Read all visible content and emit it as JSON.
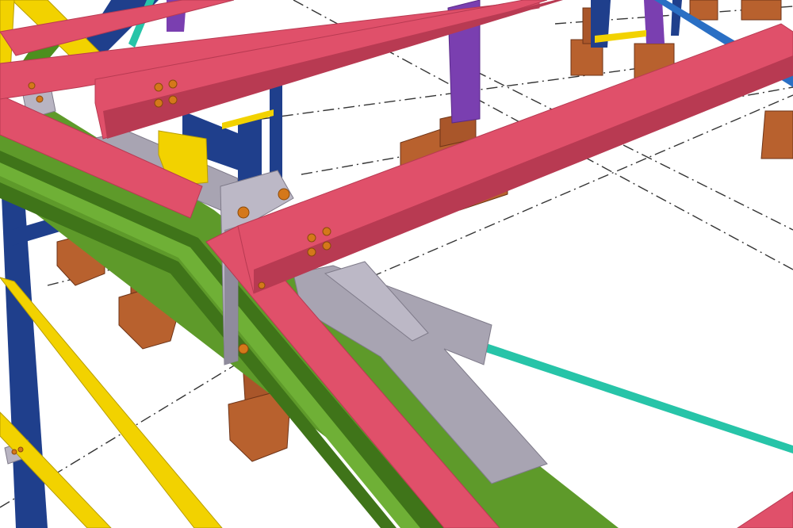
{
  "scene": {
    "kind": "3D structural steel model view",
    "colors": {
      "background": "#ffffff",
      "rafter_red": "#e0506a",
      "rafter_red_dark": "#b83a52",
      "beam_green": "#5e9a2a",
      "beam_green_dark": "#3f7419",
      "girt_yellow": "#f2d200",
      "column_blue": "#1f3f8c",
      "column_purple": "#7a3fb0",
      "footing_brown": "#b8612e",
      "footing_brown_dark": "#8c4420",
      "plate_grey": "#a8a4b2",
      "plate_grey_dark": "#7f7b8a",
      "bracing_cyan": "#27c4a8",
      "bolt_orange": "#d4781a",
      "gridline": "#333333"
    },
    "members": [
      {
        "name": "rafter",
        "color_key": "rafter_red"
      },
      {
        "name": "main-beam",
        "color_key": "beam_green"
      },
      {
        "name": "girt",
        "color_key": "girt_yellow"
      },
      {
        "name": "column",
        "color_key": "column_blue"
      },
      {
        "name": "column-secondary",
        "color_key": "column_purple"
      },
      {
        "name": "footing",
        "color_key": "footing_brown"
      },
      {
        "name": "connection-plate",
        "color_key": "plate_grey"
      },
      {
        "name": "bracing-rod",
        "color_key": "bracing_cyan"
      },
      {
        "name": "bolt",
        "color_key": "bolt_orange"
      }
    ]
  }
}
